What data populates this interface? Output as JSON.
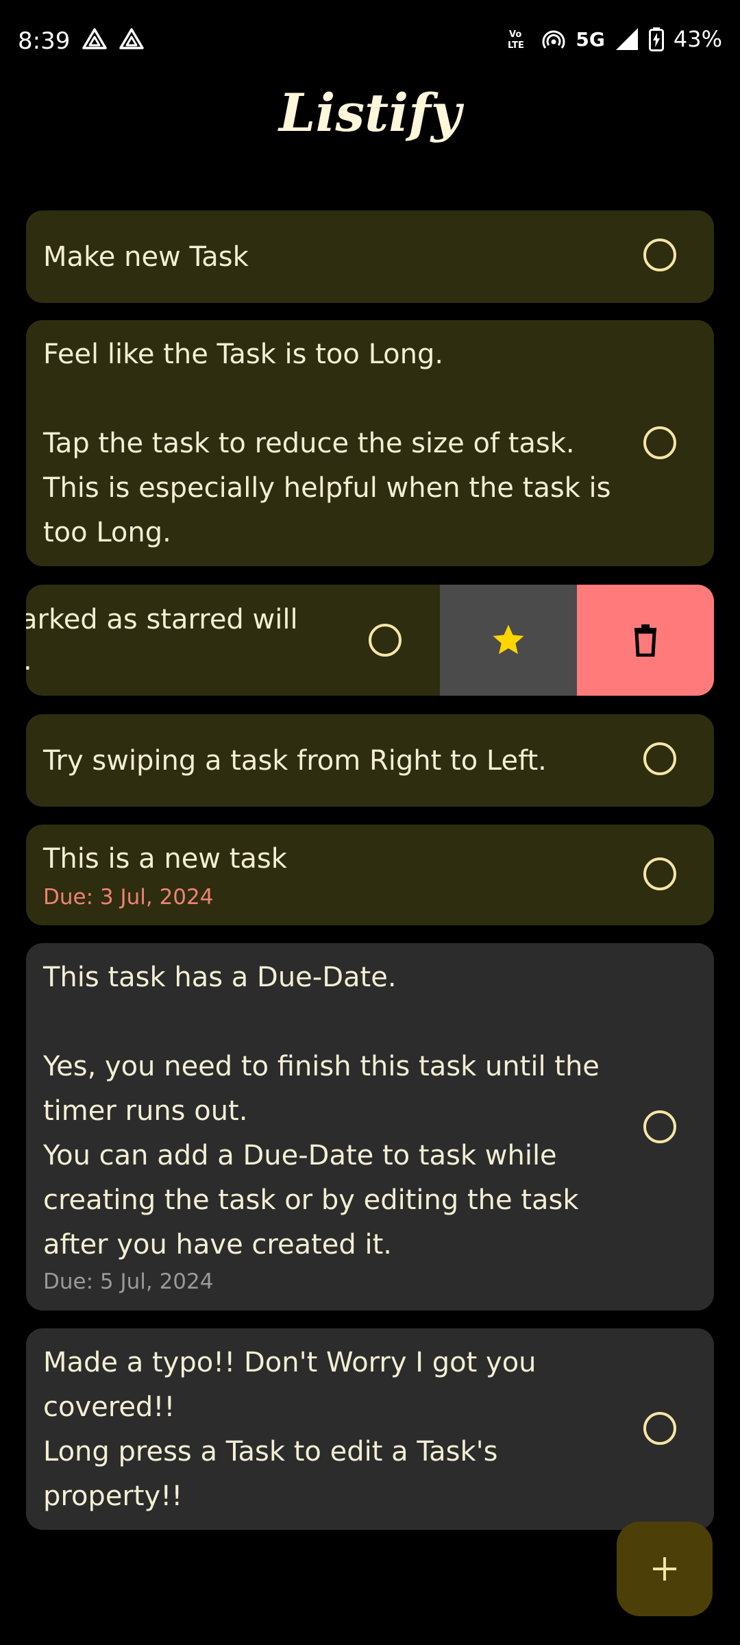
{
  "status_bar": {
    "time": "8:39",
    "network_label": "5G",
    "battery_percent": "43%",
    "left_icons": [
      "drive-triangle-icon",
      "drive-triangle-icon"
    ],
    "right_icons": [
      "volte-icon",
      "hotspot-icon",
      "5g-icon",
      "signal-icon",
      "battery-charging-icon"
    ]
  },
  "header": {
    "title": "Listify"
  },
  "tasks": [
    {
      "text": "Make new Task",
      "due": "",
      "color": "#2e2d10"
    },
    {
      "text": "Feel like the Task is too Long.\n\nTap the task to reduce the size of task.\nThis is especially helpful when the task is\ntoo Long.",
      "due": "",
      "color": "#2e2d10"
    },
    {
      "text_line1": "arked as starred will",
      "text_line2": ".",
      "color": "#2e2d10",
      "swiped": true,
      "actions": [
        "star-icon",
        "trash-icon"
      ]
    },
    {
      "text": "Try swiping a task from Right to Left.",
      "due": "",
      "color": "#2e2d10"
    },
    {
      "text": "This is a new task",
      "due": "Due: 3 Jul, 2024",
      "due_color": "#f08274",
      "color": "#2e2d10"
    },
    {
      "text": "This task has a Due-Date.\n\nYes, you need to finish this task until the\ntimer runs out.\nYou can add a Due-Date to task while\ncreating the task or by editing the task\nafter you have created it.",
      "due": "Due: 5 Jul, 2024",
      "due_color": "#9a9a9a",
      "color": "#2c2c2c"
    },
    {
      "text": "Made a typo!! Don't Worry I got you\ncovered!!\nLong press a Task to edit a Task's\nproperty!!",
      "due": "",
      "color": "#2c2c2c"
    }
  ],
  "fab": {
    "icon": "plus-icon",
    "color": "#4d3f08"
  },
  "colors": {
    "background": "#000000",
    "task_card": "#2e2d10",
    "task_card_due": "#2c2c2c",
    "checkbox": "#f6e6a6",
    "star": "#ffd500",
    "delete": "#ff7b7b"
  }
}
